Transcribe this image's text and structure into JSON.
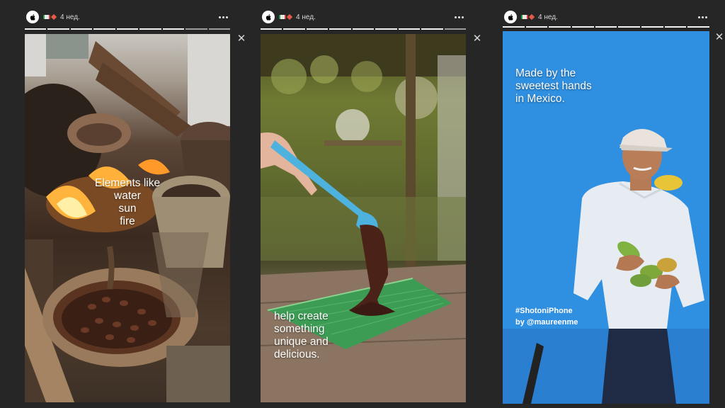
{
  "stories": [
    {
      "time": "4 нед.",
      "caption_lines": [
        "Elements like",
        "water",
        "sun",
        "fire"
      ]
    },
    {
      "time": "4 нед.",
      "caption_lines": [
        "help create",
        "something",
        "unique and",
        "delicious."
      ]
    },
    {
      "time": "4 нед.",
      "caption_lines": [
        "Made by the",
        "sweetest hands",
        "in Mexico."
      ],
      "hashtag": "#ShotoniPhone",
      "credit": "by @maureenme"
    }
  ],
  "icons": {
    "avatar": "apple-logo-icon",
    "menu": "more-dots-icon",
    "close": "close-icon",
    "close_glyph": "✕"
  },
  "colors": {
    "background": "#262626",
    "story3_blue": "#2f8fe0"
  }
}
